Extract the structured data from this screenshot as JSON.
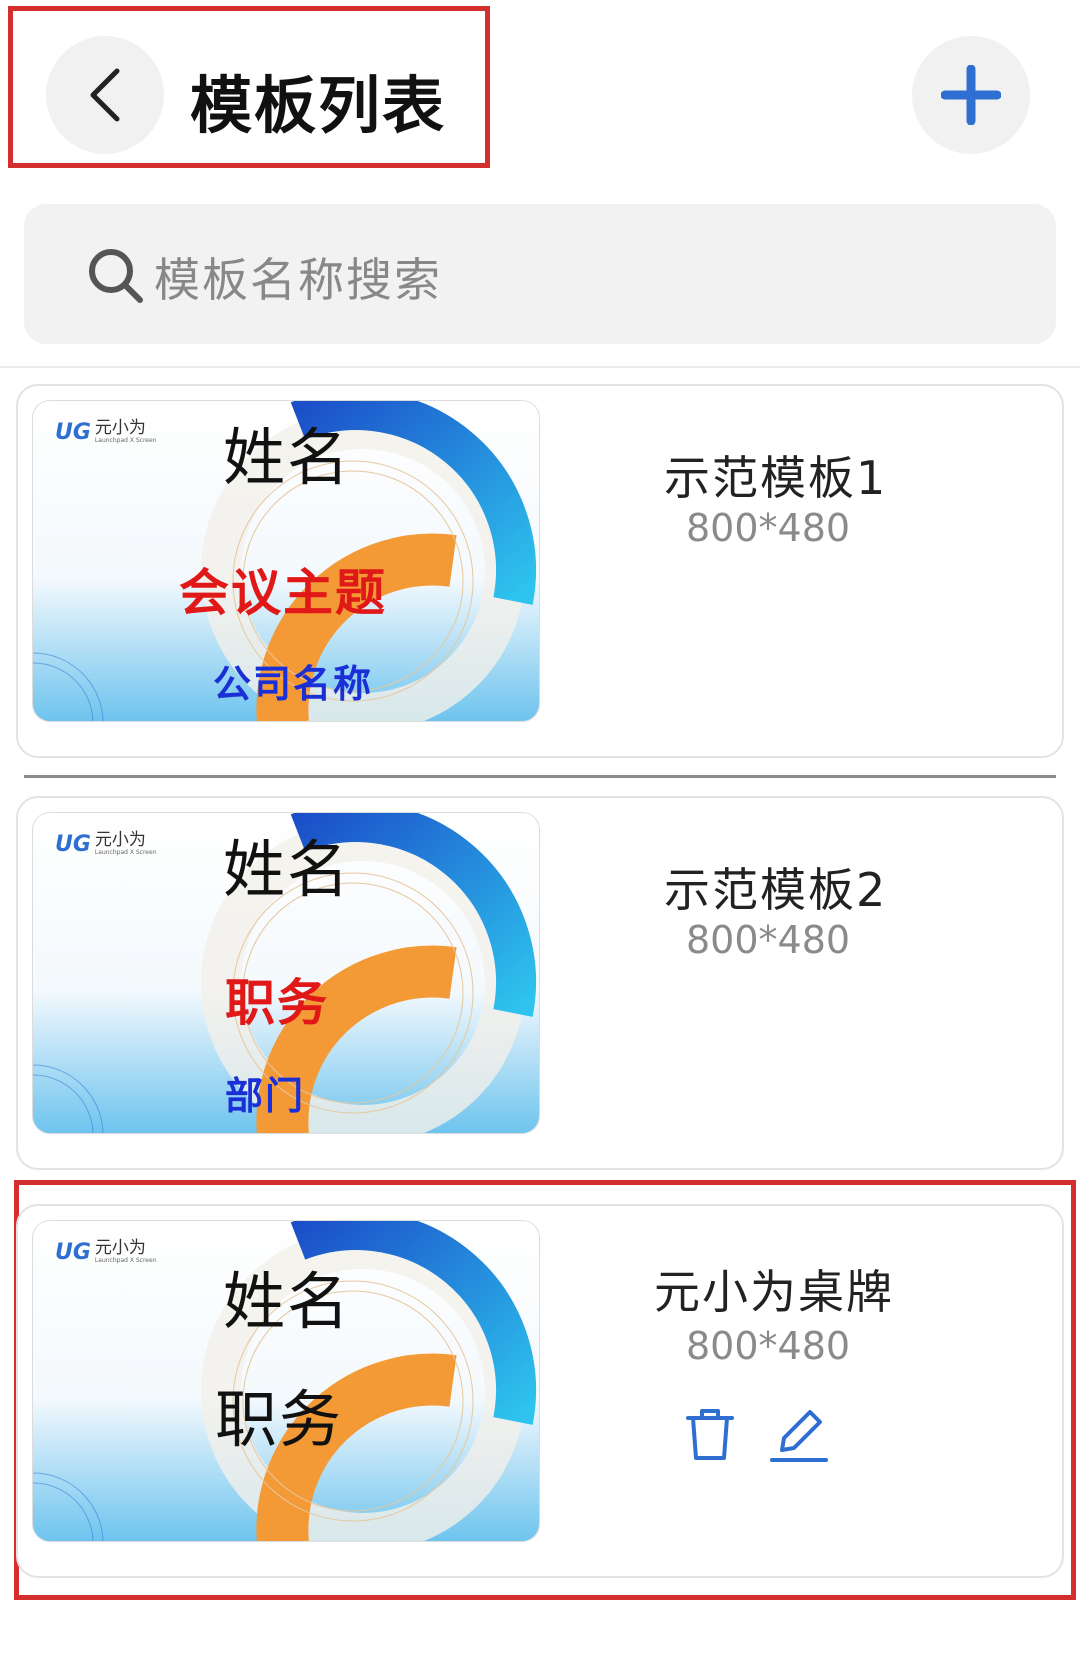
{
  "header": {
    "title": "模板列表",
    "back_icon": "chevron-left-icon",
    "add_icon": "plus-icon",
    "accent_color": "#2f6fd1"
  },
  "search": {
    "placeholder": "模板名称搜索",
    "icon": "search-icon"
  },
  "templates": [
    {
      "name": "示范模板1",
      "size": "800*480",
      "preview": {
        "logo": "元小为",
        "logo_sub": "Launchpad X Screen",
        "line1": "姓名",
        "line2": "会议主题",
        "line3": "公司名称"
      }
    },
    {
      "name": "示范模板2",
      "size": "800*480",
      "preview": {
        "logo": "元小为",
        "logo_sub": "Launchpad X Screen",
        "line1": "姓名",
        "line2": "职务",
        "line3": "部门"
      }
    },
    {
      "name": "元小为桌牌",
      "size": "800*480",
      "preview": {
        "logo": "元小为",
        "logo_sub": "Launchpad X Screen",
        "line1": "姓名",
        "line2": "职务"
      },
      "actions": {
        "delete_icon": "trash-icon",
        "edit_icon": "pencil-icon"
      }
    }
  ]
}
